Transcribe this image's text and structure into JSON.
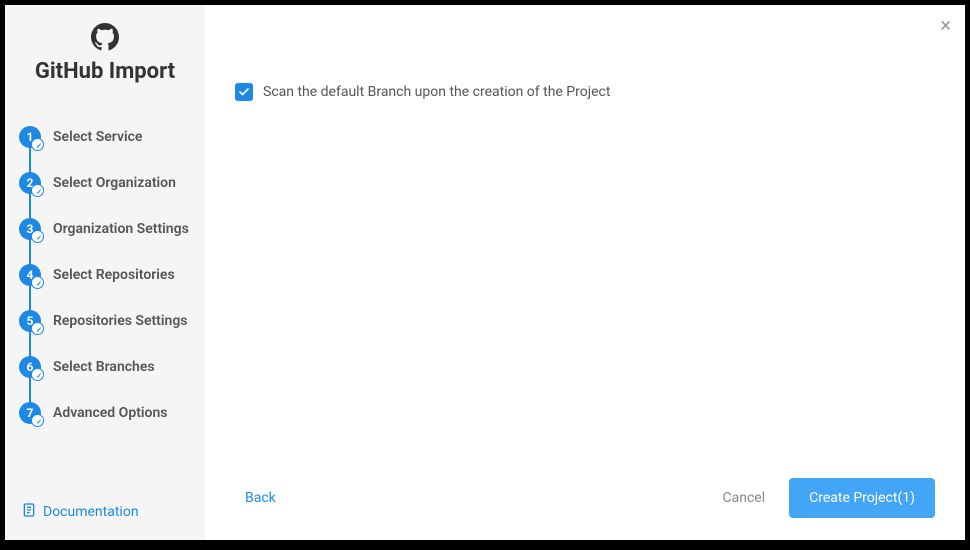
{
  "sidebar": {
    "title": "GitHub Import",
    "steps": [
      {
        "number": "1",
        "label": "Select Service"
      },
      {
        "number": "2",
        "label": "Select Organization"
      },
      {
        "number": "3",
        "label": "Organization Settings"
      },
      {
        "number": "4",
        "label": "Select Repositories"
      },
      {
        "number": "5",
        "label": "Repositories Settings"
      },
      {
        "number": "6",
        "label": "Select Branches"
      },
      {
        "number": "7",
        "label": "Advanced Options"
      }
    ],
    "documentation_label": "Documentation"
  },
  "main": {
    "scan_checkbox_label": "Scan the default Branch upon the creation of the Project",
    "scan_checkbox_checked": true
  },
  "footer": {
    "back_label": "Back",
    "cancel_label": "Cancel",
    "create_label": "Create Project(1)"
  }
}
